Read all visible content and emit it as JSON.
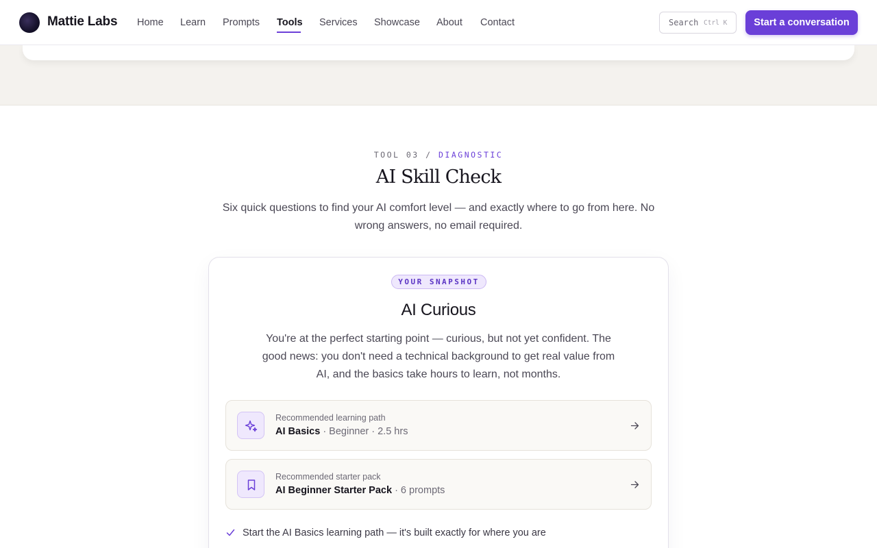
{
  "brand": {
    "name": "Mattie Labs"
  },
  "nav": {
    "items": [
      {
        "label": "Home"
      },
      {
        "label": "Learn"
      },
      {
        "label": "Prompts"
      },
      {
        "label": "Tools",
        "active": true
      },
      {
        "label": "Services"
      },
      {
        "label": "Showcase"
      },
      {
        "label": "About"
      },
      {
        "label": "Contact"
      }
    ]
  },
  "search": {
    "label": "Search",
    "shortcut": "Ctrl K"
  },
  "cta": {
    "label": "Start a conversation"
  },
  "section": {
    "eyebrow_prefix": "TOOL 03 /",
    "eyebrow_accent": "DIAGNOSTIC",
    "title": "AI Skill Check",
    "subtitle": "Six quick questions to find your AI comfort level — and exactly where to go from here. No wrong answers, no email required."
  },
  "result": {
    "badge": "YOUR SNAPSHOT",
    "title": "AI Curious",
    "description": "You're at the perfect starting point — curious, but not yet confident. The good news: you don't need a technical background to get real value from AI, and the basics take hours to learn, not months.",
    "recommendations": [
      {
        "label": "Recommended learning path",
        "name": "AI Basics",
        "meta": "· Beginner · 2.5 hrs",
        "icon": "sparkle-icon"
      },
      {
        "label": "Recommended starter pack",
        "name": "AI Beginner Starter Pack",
        "meta": "· 6 prompts",
        "icon": "bookmark-icon"
      }
    ],
    "next_steps": [
      "Start the AI Basics learning path — it's built exactly for where you are"
    ]
  },
  "colors": {
    "accent": "#6a3fd8",
    "band": "#f4f2ee",
    "badge_bg": "#efe8fd"
  }
}
